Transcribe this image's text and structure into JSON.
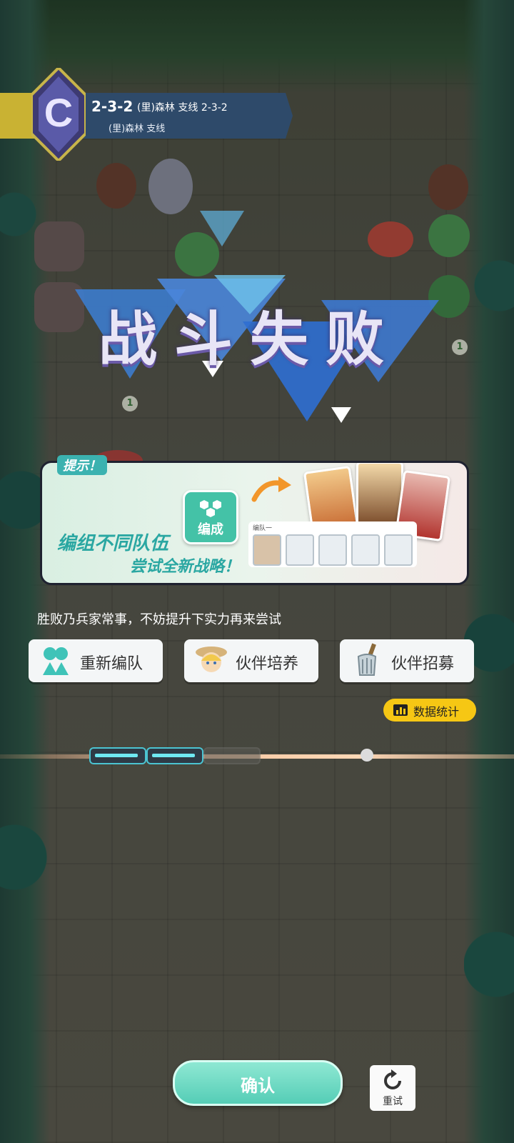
{
  "stage": {
    "badge_letter": "C",
    "id": "2-3-2",
    "title_line1": "(里)森林 支线 2-3-2",
    "title_line2": "(里)森林 支线"
  },
  "result": {
    "title": "战斗失败"
  },
  "map_counters": [
    "1",
    "1"
  ],
  "hint": {
    "tag": "提示！",
    "line1": "编组不同队伍",
    "line2": "尝试全新战略！",
    "formation_button": "编成",
    "team_label": "编队一"
  },
  "advice": "胜败乃兵家常事，不妨提升下实力再来尝试",
  "actions": [
    {
      "label": "重新编队",
      "icon": "team-icon"
    },
    {
      "label": "伙伴培养",
      "icon": "hero-portrait-icon"
    },
    {
      "label": "伙伴招募",
      "icon": "recruit-icon"
    }
  ],
  "stats_button": "数据统计",
  "wave_progress": {
    "completed": 2,
    "total": 3
  },
  "confirm_button": "确认",
  "retry_button": "重试",
  "colors": {
    "accent_teal": "#55cdb6",
    "banner_gold": "#c9b233",
    "banner_blue": "#2e4a6a",
    "stats_yellow": "#f6c714"
  }
}
